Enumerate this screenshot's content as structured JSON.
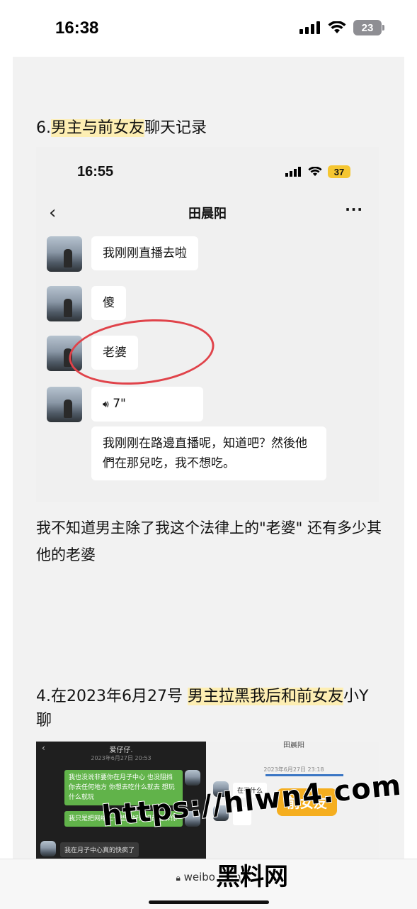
{
  "status_bar": {
    "time": "16:38",
    "battery": "23",
    "icons": [
      "signal-icon",
      "wifi-icon",
      "battery-icon"
    ]
  },
  "article": {
    "heading1_num": "6.",
    "heading1_hl": "男主与前女友",
    "heading1_rest": "聊天记录",
    "screenshot": {
      "time": "16:55",
      "battery": "37",
      "back": "‹",
      "title": "田晨阳",
      "more": "···",
      "messages": [
        {
          "text": "我刚刚直播去啦"
        },
        {
          "text": "傻"
        },
        {
          "text": "老婆"
        },
        {
          "text": "7\""
        },
        {
          "text": "我刚刚在路邊直播呢，知道吧？然後他們在那兒吃，我不想吃。"
        }
      ]
    },
    "paragraph": "我不知道男主除了我这个法律上的\"老婆\" 还有多少其他的老婆",
    "heading2_pre": "4.在2023年6月27号 ",
    "heading2_hl": "男主拉黑我后和前女友",
    "heading2_post": "小Y聊",
    "thumb_left": {
      "title": "爱仔仔.",
      "date": "2023年6月27日 20:53",
      "msg1": "我也没说非要你在月子中心 也没阻挡你去任何地方 你想去吃什么就去 想玩什么就玩",
      "msg2": "我只是把网络上一些不好的提前告诉你",
      "msg3": "我在月子中心真的快疯了"
    },
    "thumb_right": {
      "title": "田晨阳",
      "date": "2023年6月27日 23:18",
      "msg1": "在干什么",
      "tag": "前女友"
    }
  },
  "browser": {
    "url": "weibo.com"
  },
  "watermark": {
    "line1": "https://hlwn4.com",
    "line2": "黑料网"
  },
  "colors": {
    "highlight": "#fdeeb3",
    "circle": "#e0434a",
    "tag": "#f5ae1f",
    "wechat_green": "#61b34a"
  }
}
